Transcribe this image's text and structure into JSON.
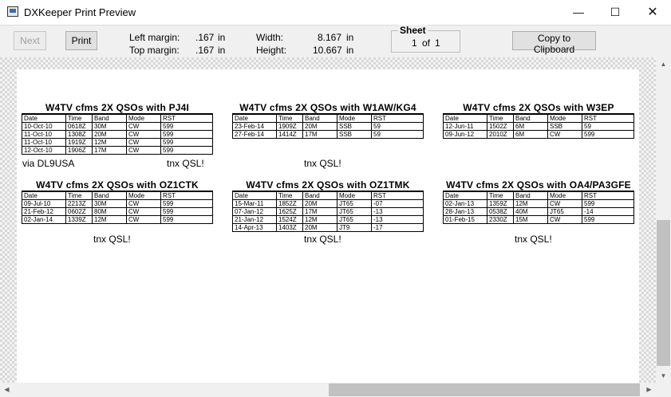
{
  "window": {
    "title": "DXKeeper Print Preview",
    "minimize": "—",
    "maximize": "☐",
    "close": "✕"
  },
  "toolbar": {
    "next_label": "Next",
    "print_label": "Print",
    "left_margin_label": "Left margin:",
    "left_margin_value": ".167",
    "left_margin_unit": "in",
    "top_margin_label": "Top margin:",
    "top_margin_value": ".167",
    "top_margin_unit": "in",
    "width_label": "Width:",
    "width_value": "8.167",
    "width_unit": "in",
    "height_label": "Height:",
    "height_value": "10.667",
    "height_unit": "in",
    "sheet_legend": "Sheet",
    "sheet_current": "1",
    "sheet_of": "of",
    "sheet_total": "1",
    "copy_label": "Copy to Clipboard"
  },
  "scrollbar": {
    "up_icon": "▲",
    "down_icon": "▼",
    "left_icon": "◀",
    "right_icon": "▶"
  },
  "headers": [
    "Date",
    "Time",
    "Band",
    "Mode",
    "RST"
  ],
  "cards": [
    {
      "title": "W4TV cfms 2X QSOs with PJ4I",
      "note_left": "via DL9USA",
      "note_right": "tnx QSL!",
      "rows": [
        [
          "10-Oct-10",
          "0618Z",
          "30M",
          "CW",
          "599"
        ],
        [
          "11-Oct-10",
          "1308Z",
          "20M",
          "CW",
          "599"
        ],
        [
          "11-Oct-10",
          "1919Z",
          "12M",
          "CW",
          "599"
        ],
        [
          "12-Oct-10",
          "1906Z",
          "17M",
          "CW",
          "599"
        ]
      ]
    },
    {
      "title": "W4TV cfms 2X QSOs with W1AW/KG4",
      "note_left": "",
      "note_right": "tnx QSL!",
      "rows": [
        [
          "23-Feb-14",
          "1909Z",
          "20M",
          "SSB",
          "59"
        ],
        [
          "27-Feb-14",
          "1414Z",
          "17M",
          "SSB",
          "59"
        ]
      ]
    },
    {
      "title": "W4TV cfms 2X QSOs with W3EP",
      "note_left": "",
      "note_right": "",
      "rows": [
        [
          "12-Jun-11",
          "1502Z",
          "6M",
          "SSB",
          "59"
        ],
        [
          "09-Jun-12",
          "2010Z",
          "6M",
          "CW",
          "599"
        ]
      ]
    },
    {
      "title": "W4TV cfms 2X QSOs with OZ1CTK",
      "note_left": "",
      "note_right": "tnx QSL!",
      "rows": [
        [
          "09-Jul-10",
          "2213Z",
          "30M",
          "CW",
          "599"
        ],
        [
          "21-Feb-12",
          "0602Z",
          "80M",
          "CW",
          "599"
        ],
        [
          "02-Jan-14",
          "1339Z",
          "12M",
          "CW",
          "599"
        ]
      ]
    },
    {
      "title": "W4TV cfms 2X QSOs with OZ1TMK",
      "note_left": "",
      "note_right": "tnx QSL!",
      "rows": [
        [
          "15-Mar-11",
          "1852Z",
          "20M",
          "JT65",
          "-07"
        ],
        [
          "07-Jan-12",
          "1625Z",
          "17M",
          "JT65",
          "-13"
        ],
        [
          "21-Jan-12",
          "1524Z",
          "12M",
          "JT65",
          "-13"
        ],
        [
          "14-Apr-13",
          "1403Z",
          "20M",
          "JT9",
          "-17"
        ]
      ]
    },
    {
      "title": "W4TV cfms 2X QSOs with OA4/PA3GFE",
      "note_left": "",
      "note_right": "tnx QSL!",
      "rows": [
        [
          "02-Jan-13",
          "1359Z",
          "12M",
          "CW",
          "599"
        ],
        [
          "28-Jan-13",
          "0538Z",
          "40M",
          "JT65",
          "-14"
        ],
        [
          "01-Feb-15",
          "2330Z",
          "15M",
          "CW",
          "599"
        ]
      ]
    }
  ]
}
